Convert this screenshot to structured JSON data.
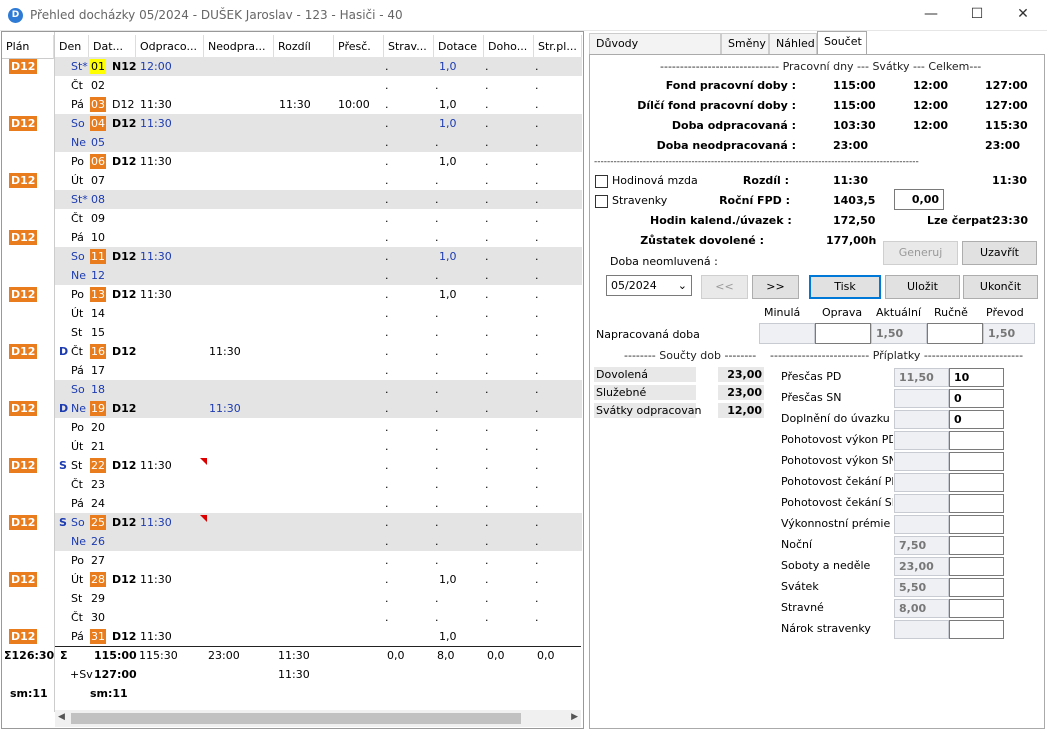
{
  "window": {
    "title": "Přehled docházky 05/2024 - DUŠEK Jaroslav - 123 - Hasiči - 40",
    "icon": "D"
  },
  "left": {
    "headers": {
      "plan": "Plán",
      "den": "Den",
      "datum": "Dat...",
      "odprac": "Odpraco...",
      "neodprac": "Neodpra...",
      "rozdil": "Rozdíl",
      "presc": "Přesč.",
      "strav": "Strav...",
      "dotace": "Dotace",
      "doho": "Doho...",
      "strpl": "Str.pl..."
    },
    "rows": [
      {
        "plan": "D12",
        "day": "St*",
        "num": "01",
        "numstyle": "yel",
        "daycolor": "blue",
        "shade": true,
        "shift": "N12",
        "odprac": "12:00",
        "odpracBlue": true,
        "dotace": "1,0",
        "dotBlue": true,
        "dots": true
      },
      {
        "day": "Čt",
        "num": "02",
        "dots": true
      },
      {
        "day": "Pá",
        "num": "03",
        "numstyle": "hl",
        "shift": "D12",
        "shiftNormal": true,
        "odprac": "11:30",
        "rozdil": "11:30",
        "presc": "10:00",
        "dotace": "1,0",
        "dots": true
      },
      {
        "plan": "D12",
        "day": "So",
        "num": "04",
        "numstyle": "hl",
        "daycolor": "blue",
        "shade": true,
        "shift": "D12",
        "odprac": "11:30",
        "odpracBlue": true,
        "dotace": "1,0",
        "dotBlue": true,
        "dots": true
      },
      {
        "day": "Ne",
        "num": "05",
        "daycolor": "blue",
        "shade": true,
        "dots": true
      },
      {
        "day": "Po",
        "num": "06",
        "numstyle": "hl",
        "shift": "D12",
        "odprac": "11:30",
        "dotace": "1,0",
        "dots": true
      },
      {
        "plan": "D12",
        "day": "Út",
        "num": "07",
        "dots": true
      },
      {
        "day": "St*",
        "num": "08",
        "daycolor": "blue",
        "shade": true,
        "dots": true
      },
      {
        "day": "Čt",
        "num": "09",
        "dots": true
      },
      {
        "plan": "D12",
        "day": "Pá",
        "num": "10",
        "dots": true
      },
      {
        "day": "So",
        "num": "11",
        "numstyle": "hl",
        "daycolor": "blue",
        "shade": true,
        "shift": "D12",
        "odprac": "11:30",
        "odpracBlue": true,
        "dotace": "1,0",
        "dotBlue": true,
        "dots": true
      },
      {
        "day": "Ne",
        "num": "12",
        "daycolor": "blue",
        "shade": true,
        "dots": true
      },
      {
        "plan": "D12",
        "day": "Po",
        "num": "13",
        "numstyle": "hl",
        "shift": "D12",
        "odprac": "11:30",
        "dotace": "1,0",
        "dots": true
      },
      {
        "day": "Út",
        "num": "14",
        "dots": true
      },
      {
        "day": "St",
        "num": "15",
        "dots": true
      },
      {
        "plan": "D12",
        "flag": "D",
        "day": "Čt",
        "num": "16",
        "numstyle": "hl",
        "shift": "D12",
        "neodprac": "11:30",
        "dots": true
      },
      {
        "day": "Pá",
        "num": "17",
        "dots": true
      },
      {
        "day": "So",
        "num": "18",
        "daycolor": "blue",
        "shade": true,
        "dots": true
      },
      {
        "plan": "D12",
        "flag": "D",
        "day": "Ne",
        "num": "19",
        "numstyle": "hl",
        "daycolor": "blue",
        "shade": true,
        "shift": "D12",
        "neodprac": "11:30",
        "neoBlue": true,
        "dots": true
      },
      {
        "day": "Po",
        "num": "20",
        "dots": true
      },
      {
        "day": "Út",
        "num": "21",
        "dots": true
      },
      {
        "plan": "D12",
        "flag": "S",
        "day": "St",
        "num": "22",
        "numstyle": "hl",
        "shift": "D12",
        "odprac": "11:30",
        "tri": true,
        "dots": true
      },
      {
        "day": "Čt",
        "num": "23",
        "dots": true
      },
      {
        "day": "Pá",
        "num": "24",
        "dots": true
      },
      {
        "plan": "D12",
        "flag": "S",
        "day": "So",
        "num": "25",
        "numstyle": "hl",
        "daycolor": "blue",
        "shade": true,
        "shift": "D12",
        "odprac": "11:30",
        "odpracBlue": true,
        "tri": true,
        "dots": true
      },
      {
        "day": "Ne",
        "num": "26",
        "daycolor": "blue",
        "shade": true,
        "dots": true
      },
      {
        "day": "Po",
        "num": "27",
        "dots": true
      },
      {
        "plan": "D12",
        "day": "Út",
        "num": "28",
        "numstyle": "hl",
        "shift": "D12",
        "odprac": "11:30",
        "dotace": "1,0",
        "dots": true
      },
      {
        "day": "St",
        "num": "29",
        "dots": true
      },
      {
        "day": "Čt",
        "num": "30",
        "dots": true
      },
      {
        "plan": "D12",
        "day": "Pá",
        "num": "31",
        "numstyle": "hl",
        "shift": "D12",
        "odprac": "11:30",
        "dotace": "1,0"
      }
    ],
    "dotchar": ".",
    "totals": {
      "plan": "Σ126:30",
      "sigma": "Σ",
      "datum": "115:00",
      "odprac": "115:30",
      "neodprac": "23:00",
      "rozdil": "11:30",
      "strav": "0,0",
      "dotace": "8,0",
      "doho": "0,0",
      "strpl": "0,0"
    },
    "svrow": {
      "label": "+Sv",
      "datum": "127:00",
      "rozdil": "11:30"
    },
    "smrow": {
      "plan": "sm:11",
      "datum": "sm:11"
    }
  },
  "tabs": [
    "Důvody nepřítomnosti",
    "Směny",
    "Náhled",
    "Součet"
  ],
  "summary": {
    "header": "------------------------------ Pracovní dny --- Svátky --- Celkem---",
    "rows": [
      {
        "label": "Fond pracovní doby :",
        "pd": "115:00",
        "sv": "12:00",
        "ce": "127:00"
      },
      {
        "label": "Dílčí fond pracovní doby :",
        "pd": "115:00",
        "sv": "12:00",
        "ce": "127:00"
      },
      {
        "label": "Doba odpracovaná :",
        "pd": "103:30",
        "sv": "12:00",
        "ce": "115:30"
      },
      {
        "label": "Doba neodpracovaná :",
        "pd": "23:00",
        "sv": "",
        "ce": "23:00"
      }
    ],
    "sep": "----------------------------------------------------------------------------------------------------",
    "hodinova": "Hodinová mzda",
    "stravenky": "Stravenky",
    "rozdil_label": "Rozdíl :",
    "rozdil_pd": "11:30",
    "rozdil_ce": "11:30",
    "rocni_label": "Roční FPD :",
    "rocni_val": "1403,5",
    "rocni_input": "0,00",
    "hodin_label": "Hodin kalend./úvazek :",
    "hodin_val": "172,50",
    "lze_label": "Lze čerpat:",
    "lze_val": "23:30",
    "zust_label": "Zůstatek dovolené :",
    "zust_val": "177,00h",
    "btn_generuj": "Generuj",
    "btn_uzavrit": "Uzavřít",
    "neoml_label": "Doba neomluvená :",
    "month": "05/2024",
    "btn_prev": "<<",
    "btn_next": ">>",
    "btn_tisk": "Tisk",
    "btn_ulozit": "Uložit",
    "btn_ukoncit": "Ukončit",
    "np_heads": [
      "Minulá",
      "Oprava",
      "Aktuální",
      "Ručně",
      "Převod"
    ],
    "np_label": "Napracovaná doba",
    "np_aktual": "1,50",
    "np_prevod": "1,50",
    "soucty_head": "-------- Součty dob --------",
    "priplatky_head": "------------------------- Příplatky -------------------------",
    "soucty": [
      {
        "label": "Dovolená",
        "val": "23,00"
      },
      {
        "label": "Služebné",
        "val": "23,00"
      },
      {
        "label": "Svátky odpracovan",
        "val": "12,00"
      }
    ],
    "priplatky": [
      {
        "label": "Přesčas PD",
        "a": "11,50",
        "b": "10"
      },
      {
        "label": "Přesčas SN",
        "a": "",
        "b": "0"
      },
      {
        "label": "Doplnění do úvazku",
        "a": "",
        "b": "0"
      },
      {
        "label": "Pohotovost výkon PD",
        "a": "",
        "b": ""
      },
      {
        "label": "Pohotovost výkon SN",
        "a": "",
        "b": ""
      },
      {
        "label": "Pohotovost čekání PD",
        "a": "",
        "b": ""
      },
      {
        "label": "Pohotovost čekání SN",
        "a": "",
        "b": ""
      },
      {
        "label": "Výkonnostní prémie",
        "a": "",
        "b": ""
      },
      {
        "label": "Noční",
        "a": "7,50",
        "b": ""
      },
      {
        "label": "Soboty a neděle",
        "a": "23,00",
        "b": ""
      },
      {
        "label": "Svátek",
        "a": "5,50",
        "b": ""
      },
      {
        "label": "Stravné",
        "a": "8,00",
        "b": ""
      },
      {
        "label": "Nárok stravenky",
        "a": "",
        "b": ""
      }
    ]
  }
}
